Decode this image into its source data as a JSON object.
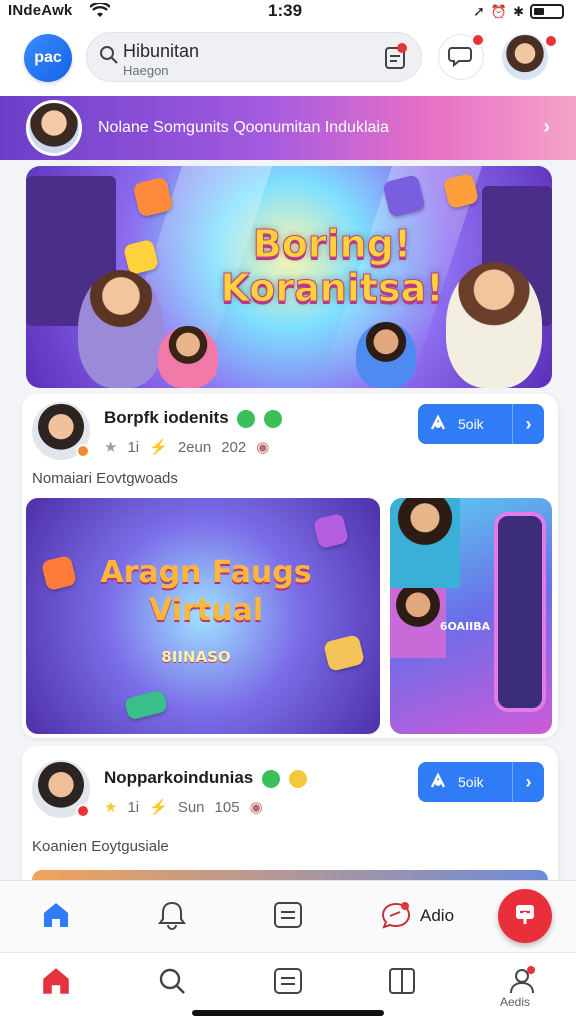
{
  "status_bar": {
    "carrier": "INdeAwk",
    "time": "1:39"
  },
  "header": {
    "logo_text": "pac",
    "search": {
      "title": "Hibunitan",
      "subtitle": "Haegon"
    }
  },
  "banner": {
    "text": "Nolane Somgunits Qoonumitan Induklaia"
  },
  "hero": {
    "headline": "Boring! Koranitsa!"
  },
  "posts": [
    {
      "title": "Borpfk iodenits",
      "stats": [
        "1i",
        "2eun",
        "202"
      ],
      "description": "Nomaiari Eovtgwoads",
      "join_label": "5oik",
      "media": [
        {
          "title": "Aragn Faugs Virtual",
          "caption": "8IINASO"
        },
        {
          "caption": "6OAIIBA"
        }
      ]
    },
    {
      "title": "Nopparkoindunias",
      "stats": [
        "1i",
        "Sun",
        "105"
      ],
      "description": "Koanien Eoytgusiale",
      "join_label": "5oik"
    }
  ],
  "action_bar": {
    "chat_label": "Adio"
  },
  "bottom_nav": {
    "profile_label": "Aedis"
  },
  "colors": {
    "accent": "#2f7cf6",
    "fab": "#e9303a",
    "banner_start": "#6b3fc9",
    "banner_end": "#f5a3c8"
  },
  "icons": [
    "wifi-icon",
    "search-icon",
    "doc-icon",
    "chat-icon",
    "home-icon",
    "bell-chat-icon",
    "list-icon",
    "message-icon",
    "book-icon",
    "person-icon"
  ]
}
